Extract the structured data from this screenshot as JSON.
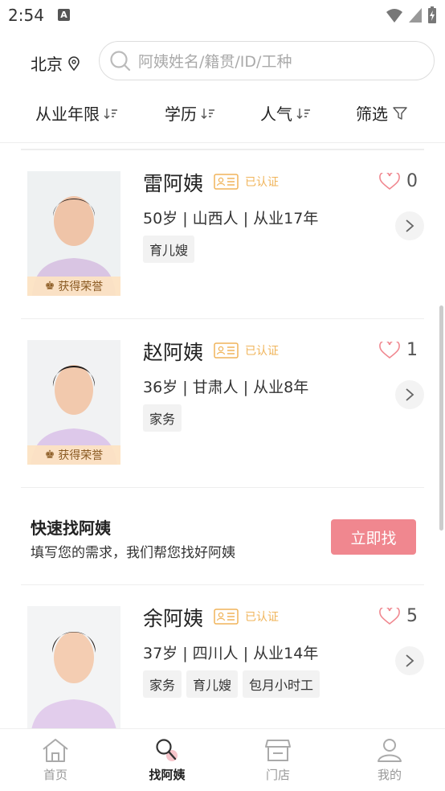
{
  "status": {
    "time": "2:54",
    "notice_letter": "A"
  },
  "header": {
    "city": "北京",
    "search_placeholder": "阿姨姓名/籍贯/ID/工种"
  },
  "filters": [
    "从业年限",
    "学历",
    "人气",
    "筛选"
  ],
  "caregivers": [
    {
      "name": "雷阿姨",
      "cert_label": "已认证",
      "likes": "0",
      "info": "50岁 | 山西人 | 从业17年",
      "tags": [
        "育儿嫂"
      ],
      "honor": "获得荣誉"
    },
    {
      "name": "赵阿姨",
      "cert_label": "已认证",
      "likes": "1",
      "info": "36岁 | 甘肃人 | 从业8年",
      "tags": [
        "家务"
      ],
      "honor": "获得荣誉"
    },
    {
      "name": "余阿姨",
      "cert_label": "已认证",
      "likes": "5",
      "info": "37岁 | 四川人 | 从业14年",
      "tags": [
        "家务",
        "育儿嫂",
        "包月小时工"
      ],
      "honor": ""
    }
  ],
  "promo": {
    "title": "快速找阿姨",
    "subtitle": "填写您的需求，我们帮您找好阿姨",
    "button": "立即找"
  },
  "tabs": [
    {
      "label": "首页",
      "icon": "home-icon"
    },
    {
      "label": "找阿姨",
      "icon": "search-auntie-icon"
    },
    {
      "label": "门店",
      "icon": "store-icon"
    },
    {
      "label": "我的",
      "icon": "profile-icon"
    }
  ],
  "colors": {
    "accent": "#f0878f",
    "cert": "#f0b45a",
    "honor_bg": "#fce3c3"
  }
}
